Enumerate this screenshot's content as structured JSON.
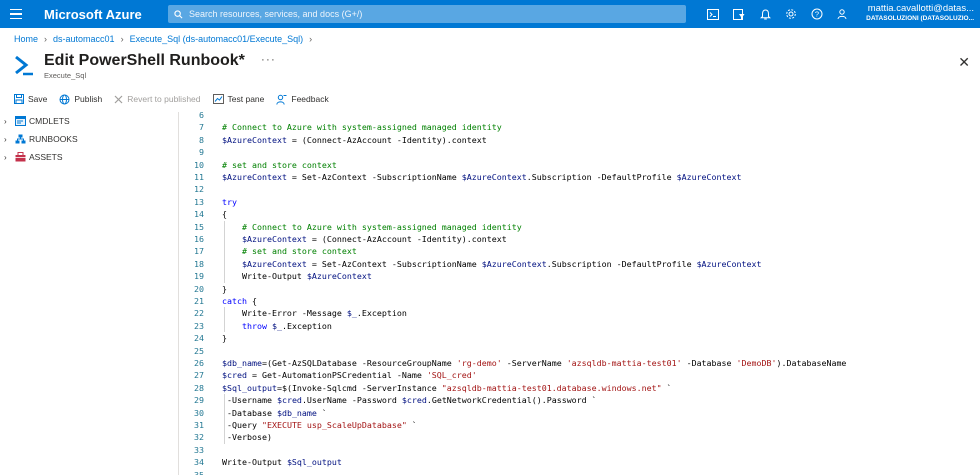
{
  "topbar": {
    "brand": "Microsoft Azure",
    "search_placeholder": "Search resources, services, and docs (G+/)",
    "account_name": "mattia.cavallotti@datas...",
    "account_directory": "DATASOLUZIONI (DATASOLUZIO..."
  },
  "breadcrumb": {
    "items": [
      "Home",
      "ds-automacc01",
      "Execute_Sql (ds-automacc01/Execute_Sql)"
    ]
  },
  "header": {
    "title": "Edit PowerShell Runbook*",
    "subtitle": "Execute_Sql",
    "more": "···"
  },
  "toolbar": {
    "save": "Save",
    "publish": "Publish",
    "revert": "Revert to published",
    "test_pane": "Test pane",
    "feedback": "Feedback"
  },
  "tree": {
    "items": [
      "CMDLETS",
      "RUNBOOKS",
      "ASSETS"
    ]
  },
  "code": {
    "lines": [
      {
        "n": "6",
        "tokens": []
      },
      {
        "n": "7",
        "tokens": [
          [
            "cmt",
            "# Connect to Azure with system-assigned managed identity"
          ]
        ]
      },
      {
        "n": "8",
        "tokens": [
          [
            "var",
            "$AzureContext"
          ],
          [
            "",
            " = (Connect-AzAccount -Identity).context"
          ]
        ]
      },
      {
        "n": "9",
        "tokens": []
      },
      {
        "n": "10",
        "tokens": [
          [
            "cmt",
            "# set and store context"
          ]
        ]
      },
      {
        "n": "11",
        "tokens": [
          [
            "var",
            "$AzureContext"
          ],
          [
            "",
            " = Set-AzContext -SubscriptionName "
          ],
          [
            "var",
            "$AzureContext"
          ],
          [
            "",
            ".Subscription -DefaultProfile "
          ],
          [
            "var",
            "$AzureContext"
          ]
        ]
      },
      {
        "n": "12",
        "tokens": []
      },
      {
        "n": "13",
        "tokens": [
          [
            "kw",
            "try"
          ]
        ]
      },
      {
        "n": "14",
        "tokens": [
          [
            "",
            "{"
          ]
        ]
      },
      {
        "n": "15",
        "tokens": [
          [
            "",
            "    "
          ],
          [
            "cmt",
            "# Connect to Azure with system-assigned managed identity"
          ]
        ]
      },
      {
        "n": "16",
        "tokens": [
          [
            "",
            "    "
          ],
          [
            "var",
            "$AzureContext"
          ],
          [
            "",
            " = (Connect-AzAccount -Identity).context"
          ]
        ]
      },
      {
        "n": "17",
        "tokens": [
          [
            "",
            "    "
          ],
          [
            "cmt",
            "# set and store context"
          ]
        ]
      },
      {
        "n": "18",
        "tokens": [
          [
            "",
            "    "
          ],
          [
            "var",
            "$AzureContext"
          ],
          [
            "",
            " = Set-AzContext -SubscriptionName "
          ],
          [
            "var",
            "$AzureContext"
          ],
          [
            "",
            ".Subscription -DefaultProfile "
          ],
          [
            "var",
            "$AzureContext"
          ]
        ]
      },
      {
        "n": "19",
        "tokens": [
          [
            "",
            "    Write-Output "
          ],
          [
            "var",
            "$AzureContext"
          ]
        ]
      },
      {
        "n": "20",
        "tokens": [
          [
            "",
            "}"
          ]
        ]
      },
      {
        "n": "21",
        "tokens": [
          [
            "kw",
            "catch"
          ],
          [
            "",
            " {"
          ]
        ]
      },
      {
        "n": "22",
        "tokens": [
          [
            "",
            "    Write-Error -Message "
          ],
          [
            "var",
            "$_"
          ],
          [
            "",
            ".Exception"
          ]
        ]
      },
      {
        "n": "23",
        "tokens": [
          [
            "",
            "    "
          ],
          [
            "kw",
            "throw"
          ],
          [
            "",
            " "
          ],
          [
            "var",
            "$_"
          ],
          [
            "",
            ".Exception"
          ]
        ]
      },
      {
        "n": "24",
        "tokens": [
          [
            "",
            "}"
          ]
        ]
      },
      {
        "n": "25",
        "tokens": []
      },
      {
        "n": "26",
        "tokens": [
          [
            "var",
            "$db_name"
          ],
          [
            "",
            "=(Get-AzSQLDatabase -ResourceGroupName "
          ],
          [
            "str",
            "'rg-demo'"
          ],
          [
            "",
            " -ServerName "
          ],
          [
            "str",
            "'azsqldb-mattia-test01'"
          ],
          [
            "",
            " -Database "
          ],
          [
            "str",
            "'DemoDB'"
          ],
          [
            "",
            ").DatabaseName"
          ]
        ]
      },
      {
        "n": "27",
        "tokens": [
          [
            "var",
            "$cred"
          ],
          [
            "",
            " = Get-AutomationPSCredential -Name "
          ],
          [
            "str",
            "'SQL_cred'"
          ]
        ]
      },
      {
        "n": "28",
        "tokens": [
          [
            "var",
            "$Sql_output"
          ],
          [
            "",
            "=$(Invoke-Sqlcmd -ServerInstance "
          ],
          [
            "str",
            "\"azsqldb-mattia-test01.database.windows.net\""
          ],
          [
            "",
            " `"
          ]
        ]
      },
      {
        "n": "29",
        "tokens": [
          [
            "",
            " -Username "
          ],
          [
            "var",
            "$cred"
          ],
          [
            "",
            ".UserName -Password "
          ],
          [
            "var",
            "$cred"
          ],
          [
            "",
            ".GetNetworkCredential().Password `"
          ]
        ]
      },
      {
        "n": "30",
        "tokens": [
          [
            "",
            " -Database "
          ],
          [
            "var",
            "$db_name"
          ],
          [
            "",
            " `"
          ]
        ]
      },
      {
        "n": "31",
        "tokens": [
          [
            "",
            " -Query "
          ],
          [
            "str",
            "\"EXECUTE usp_ScaleUpDatabase\""
          ],
          [
            "",
            " `"
          ]
        ]
      },
      {
        "n": "32",
        "tokens": [
          [
            "",
            " -Verbose)"
          ]
        ]
      },
      {
        "n": "33",
        "tokens": []
      },
      {
        "n": "34",
        "tokens": [
          [
            "",
            "Write-Output "
          ],
          [
            "var",
            "$Sql_output"
          ]
        ]
      },
      {
        "n": "35",
        "tokens": []
      }
    ]
  }
}
